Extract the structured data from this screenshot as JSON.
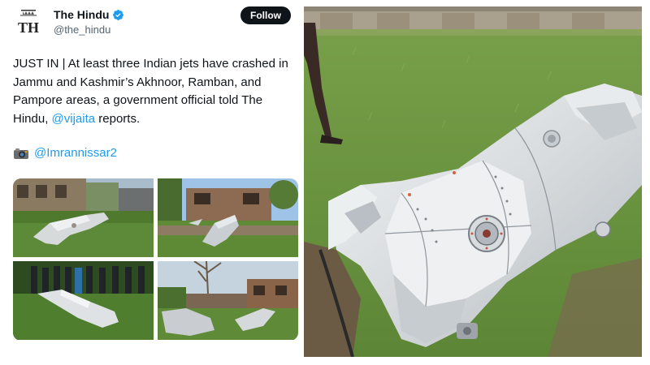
{
  "account": {
    "name": "The Hindu",
    "handle": "@the_hindu",
    "logo_text": "TH",
    "verified_icon": "verified-badge-icon"
  },
  "follow_label": "Follow",
  "tweet": {
    "text_part1": "JUST IN | At least three Indian jets have crashed in Jammu and Kashmir’s Akhnoor, Ramban, and Pampore areas, a government official told The Hindu, ",
    "mention": "@vijaita",
    "text_part2": " reports.",
    "credit_icon": "camera-icon",
    "credit_handle": "@Imrannissar2"
  },
  "colors": {
    "link": "#1d9bf0",
    "text": "#0f1419",
    "muted": "#536471",
    "grass": "#5f8a3a",
    "debris": "#d9dcdf"
  }
}
